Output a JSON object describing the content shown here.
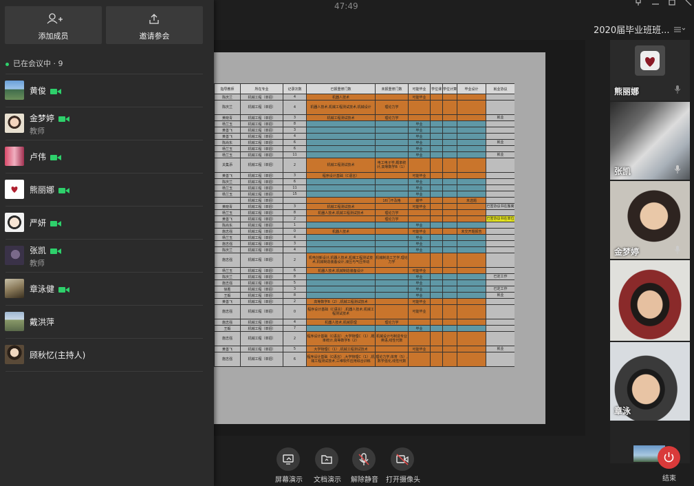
{
  "top_actions": {
    "add_member": "添加成员",
    "invite": "邀请参会"
  },
  "status": {
    "in_meeting": "已在会议中 · 9"
  },
  "participants": [
    {
      "name": "黄俊",
      "role": "",
      "camera": true
    },
    {
      "name": "金梦婷",
      "role": "教师",
      "camera": true
    },
    {
      "name": "卢伟",
      "role": "",
      "camera": true
    },
    {
      "name": "熊丽娜",
      "role": "",
      "camera": true
    },
    {
      "name": "严妍",
      "role": "",
      "camera": true
    },
    {
      "name": "张凯",
      "role": "教师",
      "camera": true
    },
    {
      "name": "章泳健",
      "role": "",
      "camera": true
    },
    {
      "name": "戴洪萍",
      "role": "",
      "camera": false
    },
    {
      "name": "顾秋忆(主持人)",
      "role": "",
      "camera": false
    }
  ],
  "header": {
    "timer": "47:49",
    "meeting_title": "2020届毕业班班..."
  },
  "video_tiles": [
    {
      "name": "熊丽娜"
    },
    {
      "name": "张凯"
    },
    {
      "name": "金梦婷"
    },
    {
      "name": ""
    },
    {
      "name": "章泳"
    }
  ],
  "spreadsheet": {
    "headers": [
      "指导教师",
      "所在专业",
      "记录次数",
      "已报重修门数",
      "未报重修门数",
      "可能毕业",
      "学位课",
      "学位计算机",
      "毕业设计",
      "就业协议"
    ],
    "rows": [
      [
        "陈庆兰",
        "机械工程（单招）",
        "4",
        "机器人技术",
        "",
        "可能毕业",
        "",
        "",
        "",
        ""
      ],
      [
        "陈庆兰",
        "机械工程（单招）",
        "4",
        "机器人技术,机械工程测试技术,机械设计",
        "理论力学",
        "",
        "",
        "",
        "",
        ""
      ],
      [
        "黄晓青",
        "机械工程（单招）",
        "3",
        "机械工程测试技术",
        "理论力学",
        "",
        "",
        "",
        "",
        "就业"
      ],
      [
        "杨兰玉",
        "机械工程（单招）",
        "8",
        "",
        "",
        "毕业",
        "",
        "",
        "",
        ""
      ],
      [
        "黄善飞",
        "机械工程（单招）",
        "3",
        "",
        "",
        "毕业",
        "",
        "",
        "",
        ""
      ],
      [
        "黄善飞",
        "机械工程（单招）",
        "4",
        "",
        "",
        "毕业",
        "",
        "",
        "",
        ""
      ],
      [
        "陈尚东",
        "机械工程（单招）",
        "6",
        "",
        "",
        "毕业",
        "",
        "",
        "",
        "就业"
      ],
      [
        "杨兰玉",
        "机械工程（单招）",
        "6",
        "",
        "",
        "毕业",
        "",
        "",
        "",
        ""
      ],
      [
        "杨兰玉",
        "机械工程（单招）",
        "11",
        "",
        "",
        "毕业",
        "",
        "",
        "",
        "就业"
      ],
      [
        "关集添",
        "机械工程（单招）",
        "2",
        "机械工程测试技术",
        "电工电子学,概率统计,高等数学B（1）",
        "",
        "",
        "",
        "",
        ""
      ],
      [
        "黄善飞",
        "机械工程（单招）",
        "3",
        "程序设计基础（C语言）",
        "",
        "可能毕业",
        "",
        "",
        "",
        ""
      ],
      [
        "陈庆兰",
        "机械工程（单招）",
        "6",
        "",
        "",
        "毕业",
        "",
        "",
        "",
        ""
      ],
      [
        "杨兰玉",
        "机械工程（单招）",
        "11",
        "",
        "",
        "毕业",
        "",
        "",
        "",
        ""
      ],
      [
        "杨兰玉",
        "机械工程（单招）",
        "15",
        "",
        "",
        "毕业",
        "",
        "",
        "",
        ""
      ],
      [
        "",
        "机械工程（单招）",
        "",
        "",
        "16门不及格",
        "缓毕",
        "",
        "",
        "未选题",
        ""
      ],
      [
        "黄晓青",
        "机械工程（单招）",
        "3",
        "机械工程测试技术",
        "",
        "可能毕业",
        "",
        "",
        "",
        "已签协议书在搬离"
      ],
      [
        "杨兰玉",
        "机械工程（单招）",
        "8",
        "机器人技术,机械工程测试技术",
        "理论力学",
        "",
        "",
        "",
        "",
        ""
      ],
      [
        "黄善飞",
        "机械工程（单招）",
        "2",
        "",
        "理论力学",
        "",
        "",
        "",
        "",
        "已签协议书在单位"
      ],
      [
        "陈尚东",
        "机械工程（单招）",
        "1",
        "",
        "",
        "毕业",
        "",
        "",
        "",
        ""
      ],
      [
        "施志强",
        "机械工程（单招）",
        "0",
        "机器人技术",
        "",
        "可能毕业",
        "",
        "",
        "未交开题报告",
        ""
      ],
      [
        "杨兰玉",
        "机械工程（单招）",
        "4",
        "",
        "",
        "毕业",
        "",
        "",
        "",
        ""
      ],
      [
        "施志强",
        "机械工程（单招）",
        "3",
        "",
        "",
        "毕业",
        "",
        "",
        "",
        ""
      ],
      [
        "陈庆兰",
        "机械工程（单招）",
        "4",
        "",
        "",
        "毕业",
        "",
        "",
        "",
        ""
      ],
      [
        "施志强",
        "机械工程（单招）",
        "2",
        "机电创新设计,机器人技术,机械工程测试技术,机械制造装备设计,液压与气压传动",
        "机械制造工艺学,理论力学",
        "",
        "",
        "",
        "",
        ""
      ],
      [
        "杨兰玉",
        "机械工程（单招）",
        "6",
        "机器人技术,机械制造装备设计",
        "",
        "可能毕业",
        "",
        "",
        "",
        ""
      ],
      [
        "陈庆兰",
        "机械工程（单招）",
        "8",
        "",
        "",
        "毕业",
        "",
        "",
        "",
        "已定工作"
      ],
      [
        "施志强",
        "机械工程（单招）",
        "5",
        "",
        "",
        "毕业",
        "",
        "",
        "",
        ""
      ],
      [
        "徐胜",
        "机械工程（单招）",
        "3",
        "",
        "",
        "毕业",
        "",
        "",
        "",
        "已定工作"
      ],
      [
        "王毅",
        "机械工程（单招）",
        "8",
        "",
        "",
        "毕业",
        "",
        "",
        "",
        "就业"
      ],
      [
        "黄善飞",
        "机械工程（单招）",
        "2",
        "高等数学B（2）,机械工程测试技术",
        "",
        "可能毕业",
        "",
        "",
        "",
        ""
      ],
      [
        "施志强",
        "机械工程（单招）",
        "0",
        "程序设计基础（C语言）,机器人技术,机械工程测试技术",
        "",
        "可能毕业",
        "",
        "",
        "",
        ""
      ],
      [
        "施志强",
        "机械工程（单招）",
        "4",
        "机器人技术,机械原理",
        "理论力学",
        "",
        "",
        "",
        "",
        ""
      ],
      [
        "王毅",
        "机械工程（单招）",
        "7",
        "",
        "",
        "毕业",
        "",
        "",
        "",
        ""
      ],
      [
        "施志强",
        "机械工程（单招）",
        "2",
        "程序设计基础（C语言）,大学物理C（1）,概率统计,高等数学B（2）",
        "机械设计与制造专业英语,线性代数",
        "",
        "",
        "",
        "",
        ""
      ],
      [
        "黄善飞",
        "机械工程（单招）",
        "5",
        "大学物理C（1）,机械工程测试技术",
        "",
        "可能毕业",
        "",
        "",
        "",
        "就业"
      ],
      [
        "施志强",
        "机械工程（单招）",
        "6",
        "程序设计基础（C语言）,大学物理C（1）,机械工程测试技术,三维软件应用综合训练",
        "理论力学,体育（5）,数学强化,线性代数",
        "",
        "",
        "",
        "",
        ""
      ]
    ]
  },
  "toolbar": {
    "screen_share": "屏幕演示",
    "doc_share": "文档演示",
    "unmute": "解除静音",
    "camera_on": "打开摄像头",
    "end": "结束"
  },
  "colors": {
    "panel_bg": "#2b2b2b",
    "accent_green": "#2ed06b",
    "end_red": "#d93a3a",
    "row_orange": "#c9752c",
    "row_teal": "#5f98a6",
    "row_yellow": "#e6e61e"
  }
}
